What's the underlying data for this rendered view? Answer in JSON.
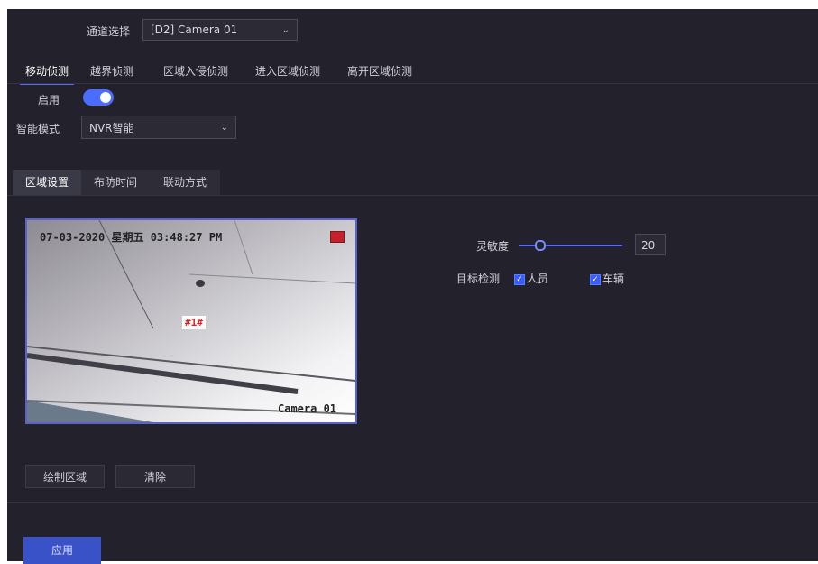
{
  "channel": {
    "label": "通道选择",
    "selected": "[D2] Camera 01"
  },
  "detection_tabs": [
    {
      "label": "移动侦测",
      "active": true
    },
    {
      "label": "越界侦测",
      "active": false
    },
    {
      "label": "区域入侵侦测",
      "active": false
    },
    {
      "label": "进入区域侦测",
      "active": false
    },
    {
      "label": "离开区域侦测",
      "active": false
    }
  ],
  "enable": {
    "label": "启用",
    "on": true
  },
  "mode": {
    "label": "智能模式",
    "selected": "NVR智能"
  },
  "settings_tabs": [
    {
      "label": "区域设置",
      "active": true
    },
    {
      "label": "布防时间",
      "active": false
    },
    {
      "label": "联动方式",
      "active": false
    }
  ],
  "video": {
    "timestamp": "07-03-2020 星期五 03:48:27 PM",
    "camera_name": "Camera 01",
    "region_label": "#1#"
  },
  "sensitivity": {
    "label": "灵敏度",
    "value": "20",
    "fraction": 0.2
  },
  "target": {
    "label": "目标检测",
    "options": [
      {
        "label": "人员",
        "checked": true
      },
      {
        "label": "车辆",
        "checked": true
      }
    ]
  },
  "buttons": {
    "draw": "绘制区域",
    "clear": "清除",
    "apply": "应用"
  },
  "colors": {
    "accent": "#4a6cff",
    "background": "#23222c"
  }
}
